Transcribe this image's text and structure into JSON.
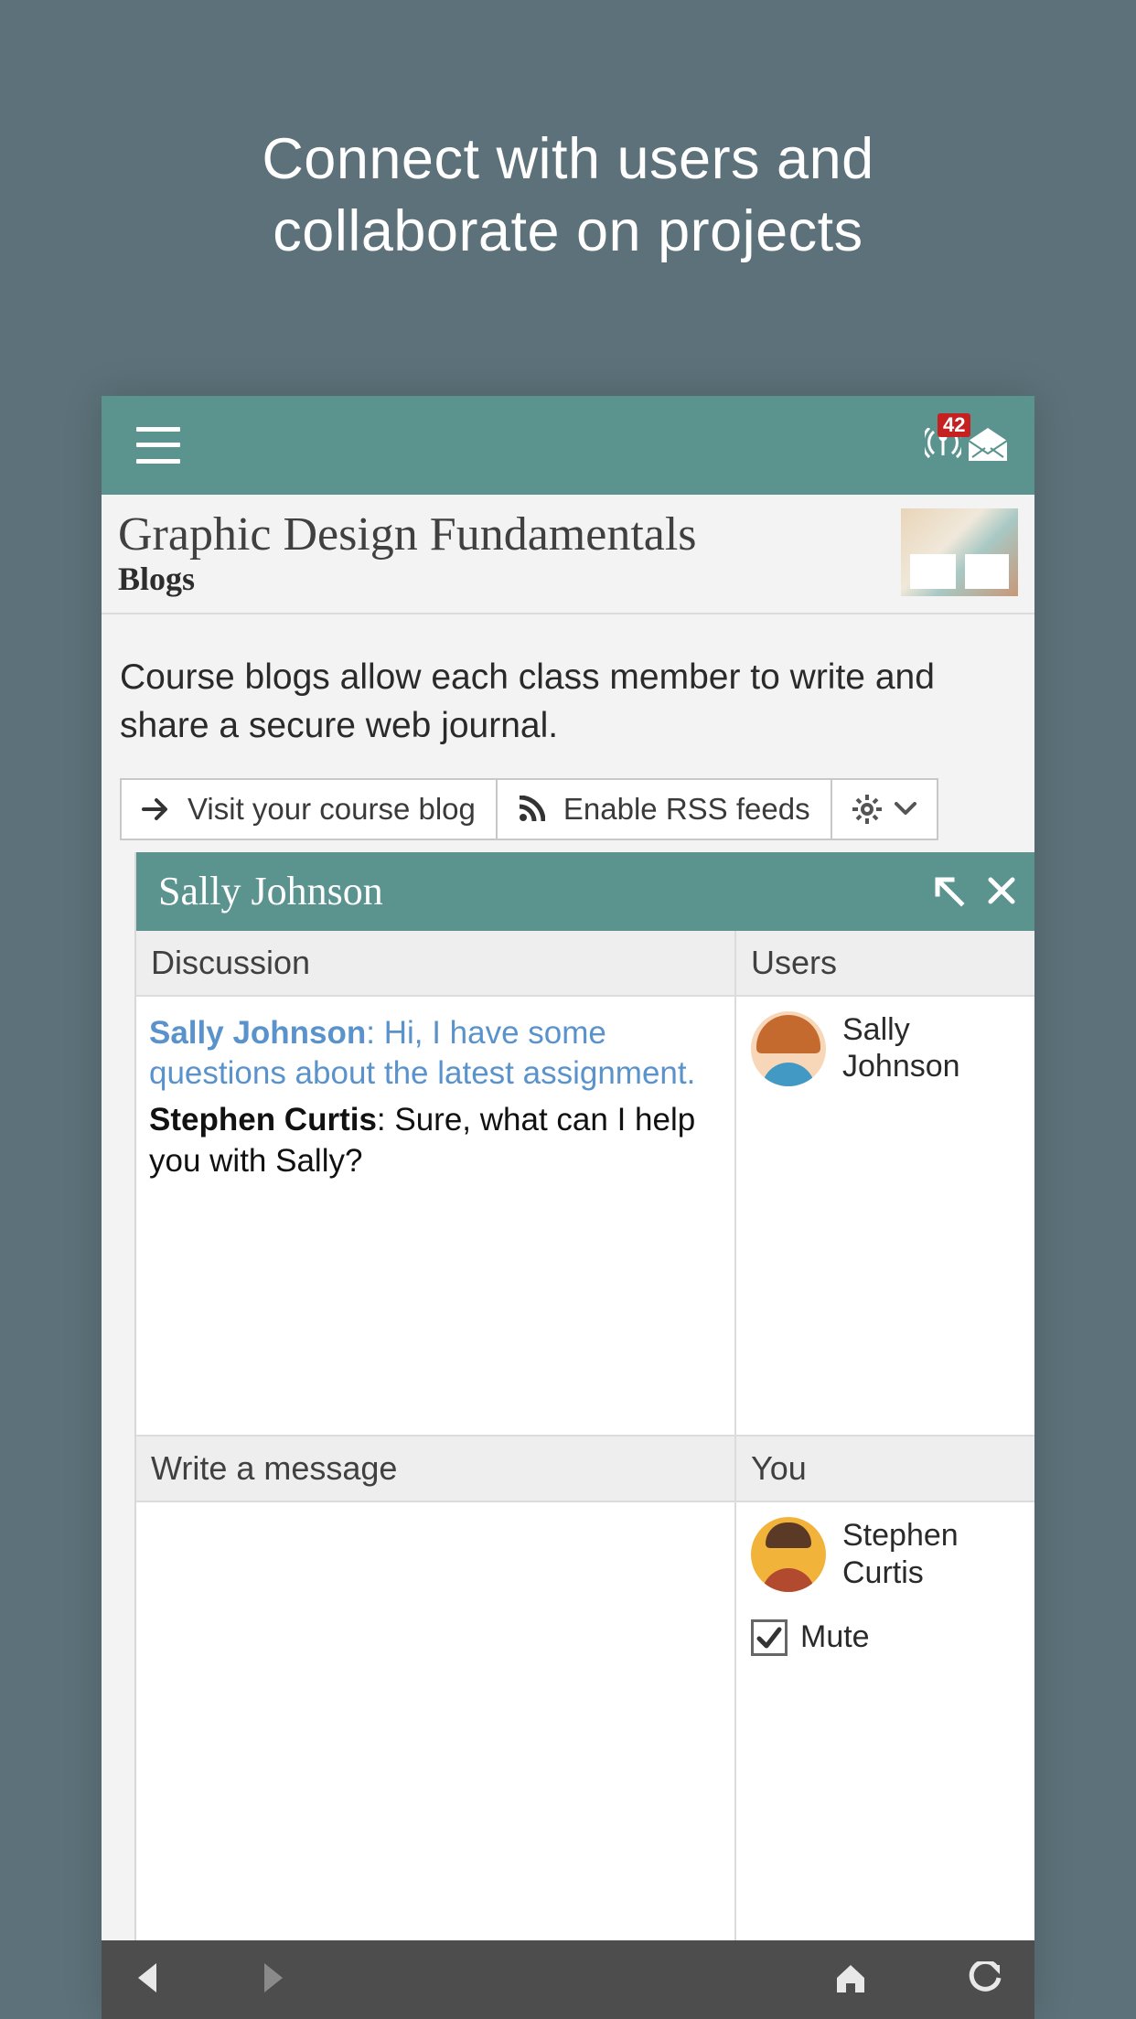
{
  "promo": {
    "line1": "Connect with users and",
    "line2": "collaborate on projects"
  },
  "header": {
    "notification_count": "42"
  },
  "course": {
    "title": "Graphic Design Fundamentals",
    "section": "Blogs"
  },
  "description": "Course blogs allow each class member to write and share a secure web journal.",
  "actions": {
    "visit_blog": "Visit your course blog",
    "enable_rss": "Enable RSS feeds"
  },
  "chat": {
    "title": "Sally Johnson",
    "headers": {
      "discussion": "Discussion",
      "users": "Users",
      "write": "Write a message",
      "you": "You"
    },
    "messages": [
      {
        "author": "Sally Johnson",
        "text": "Hi, I have some questions about the latest assignment."
      },
      {
        "author": "Stephen Curtis",
        "text": "Sure, what can I help you with Sally?"
      }
    ],
    "users": [
      {
        "name": "Sally Johnson"
      }
    ],
    "you_user": {
      "name": "Stephen Curtis"
    },
    "mute_label": "Mute",
    "mute_checked": true
  }
}
